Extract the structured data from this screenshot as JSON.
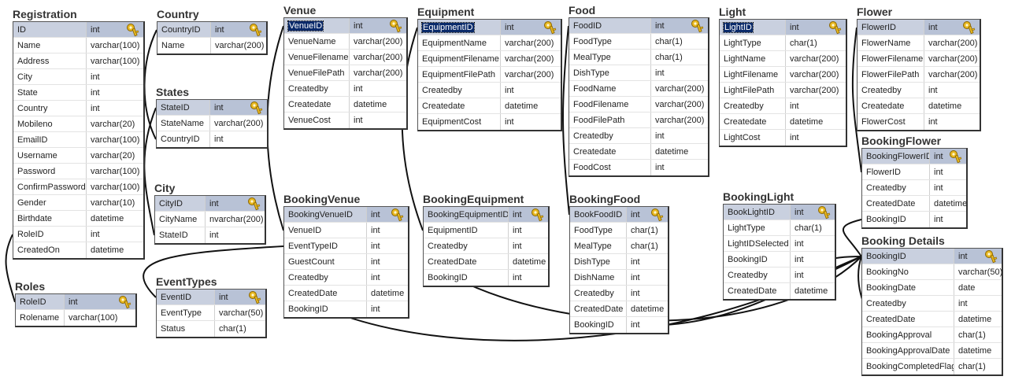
{
  "tables": [
    {
      "id": "registration",
      "title": "Registration",
      "selected": false,
      "rows": [
        {
          "name": "ID",
          "type": "int",
          "pk": true
        },
        {
          "name": "Name",
          "type": "varchar(100)"
        },
        {
          "name": "Address",
          "type": "varchar(100)"
        },
        {
          "name": "City",
          "type": "int"
        },
        {
          "name": "State",
          "type": "int"
        },
        {
          "name": "Country",
          "type": "int"
        },
        {
          "name": "Mobileno",
          "type": "varchar(20)"
        },
        {
          "name": "EmailID",
          "type": "varchar(100)"
        },
        {
          "name": "Username",
          "type": "varchar(20)"
        },
        {
          "name": "Password",
          "type": "varchar(100)"
        },
        {
          "name": "ConfirmPassword",
          "type": "varchar(100)"
        },
        {
          "name": "Gender",
          "type": "varchar(10)"
        },
        {
          "name": "Birthdate",
          "type": "datetime"
        },
        {
          "name": "RoleID",
          "type": "int"
        },
        {
          "name": "CreatedOn",
          "type": "datetime"
        }
      ]
    },
    {
      "id": "roles",
      "title": "Roles",
      "selected": false,
      "rows": [
        {
          "name": "RoleID",
          "type": "int",
          "pk": true
        },
        {
          "name": "Rolename",
          "type": "varchar(100)"
        }
      ]
    },
    {
      "id": "country",
      "title": "Country",
      "selected": false,
      "rows": [
        {
          "name": "CountryID",
          "type": "int",
          "pk": true
        },
        {
          "name": "Name",
          "type": "varchar(200)"
        }
      ]
    },
    {
      "id": "states",
      "title": "States",
      "selected": false,
      "rows": [
        {
          "name": "StateID",
          "type": "int",
          "pk": true
        },
        {
          "name": "StateName",
          "type": "varchar(200)"
        },
        {
          "name": "CountryID",
          "type": "int"
        }
      ]
    },
    {
      "id": "city",
      "title": "City",
      "selected": false,
      "rows": [
        {
          "name": "CityID",
          "type": "int",
          "pk": true
        },
        {
          "name": "CityName",
          "type": "nvarchar(200)"
        },
        {
          "name": "StateID",
          "type": "int"
        }
      ]
    },
    {
      "id": "eventtypes",
      "title": "EventTypes",
      "selected": false,
      "rows": [
        {
          "name": "EventID",
          "type": "int",
          "pk": true
        },
        {
          "name": "EventType",
          "type": "varchar(50)"
        },
        {
          "name": "Status",
          "type": "char(1)"
        }
      ]
    },
    {
      "id": "venue",
      "title": "Venue",
      "selected": true,
      "rows": [
        {
          "name": "VenueID",
          "type": "int",
          "pk": true
        },
        {
          "name": "VenueName",
          "type": "varchar(200)"
        },
        {
          "name": "VenueFilename",
          "type": "varchar(200)"
        },
        {
          "name": "VenueFilePath",
          "type": "varchar(200)"
        },
        {
          "name": "Createdby",
          "type": "int"
        },
        {
          "name": "Createdate",
          "type": "datetime"
        },
        {
          "name": "VenueCost",
          "type": "int"
        }
      ]
    },
    {
      "id": "bookingvenue",
      "title": "BookingVenue",
      "selected": false,
      "rows": [
        {
          "name": "BookingVenueID",
          "type": "int",
          "pk": true
        },
        {
          "name": "VenueID",
          "type": "int"
        },
        {
          "name": "EventTypeID",
          "type": "int"
        },
        {
          "name": "GuestCount",
          "type": "int"
        },
        {
          "name": "Createdby",
          "type": "int"
        },
        {
          "name": "CreatedDate",
          "type": "datetime"
        },
        {
          "name": "BookingID",
          "type": "int"
        }
      ]
    },
    {
      "id": "equipment",
      "title": "Equipment",
      "selected": true,
      "rows": [
        {
          "name": "EquipmentID",
          "type": "int",
          "pk": true
        },
        {
          "name": "EquipmentName",
          "type": "varchar(200)"
        },
        {
          "name": "EquipmentFilename",
          "type": "varchar(200)"
        },
        {
          "name": "EquipmentFilePath",
          "type": "varchar(200)"
        },
        {
          "name": "Createdby",
          "type": "int"
        },
        {
          "name": "Createdate",
          "type": "datetime"
        },
        {
          "name": "EquipmentCost",
          "type": "int"
        }
      ]
    },
    {
      "id": "bookingequipment",
      "title": "BookingEquipment",
      "selected": false,
      "rows": [
        {
          "name": "BookingEquipmentID",
          "type": "int",
          "pk": true
        },
        {
          "name": "EquipmentID",
          "type": "int"
        },
        {
          "name": "Createdby",
          "type": "int"
        },
        {
          "name": "CreatedDate",
          "type": "datetime"
        },
        {
          "name": "BookingID",
          "type": "int"
        }
      ]
    },
    {
      "id": "food",
      "title": "Food",
      "selected": false,
      "rows": [
        {
          "name": "FoodID",
          "type": "int",
          "pk": true
        },
        {
          "name": "FoodType",
          "type": "char(1)"
        },
        {
          "name": "MealType",
          "type": "char(1)"
        },
        {
          "name": "DishType",
          "type": "int"
        },
        {
          "name": "FoodName",
          "type": "varchar(200)"
        },
        {
          "name": "FoodFilename",
          "type": "varchar(200)"
        },
        {
          "name": "FoodFilePath",
          "type": "varchar(200)"
        },
        {
          "name": "Createdby",
          "type": "int"
        },
        {
          "name": "Createdate",
          "type": "datetime"
        },
        {
          "name": "FoodCost",
          "type": "int"
        }
      ]
    },
    {
      "id": "bookingfood",
      "title": "BookingFood",
      "selected": false,
      "rows": [
        {
          "name": "BookFoodID",
          "type": "int",
          "pk": true
        },
        {
          "name": "FoodType",
          "type": "char(1)"
        },
        {
          "name": "MealType",
          "type": "char(1)"
        },
        {
          "name": "DishType",
          "type": "int"
        },
        {
          "name": "DishName",
          "type": "int"
        },
        {
          "name": "Createdby",
          "type": "int"
        },
        {
          "name": "CreatedDate",
          "type": "datetime"
        },
        {
          "name": "BookingID",
          "type": "int"
        }
      ]
    },
    {
      "id": "light",
      "title": "Light",
      "selected": true,
      "rows": [
        {
          "name": "LightID",
          "type": "int",
          "pk": true
        },
        {
          "name": "LightType",
          "type": "char(1)"
        },
        {
          "name": "LightName",
          "type": "varchar(200)"
        },
        {
          "name": "LightFilename",
          "type": "varchar(200)"
        },
        {
          "name": "LightFilePath",
          "type": "varchar(200)"
        },
        {
          "name": "Createdby",
          "type": "int"
        },
        {
          "name": "Createdate",
          "type": "datetime"
        },
        {
          "name": "LightCost",
          "type": "int"
        }
      ]
    },
    {
      "id": "bookinglight",
      "title": "BookingLight",
      "selected": false,
      "rows": [
        {
          "name": "BookLightID",
          "type": "int",
          "pk": true
        },
        {
          "name": "LightType",
          "type": "char(1)"
        },
        {
          "name": "LightIDSelected",
          "type": "int"
        },
        {
          "name": "BookingID",
          "type": "int"
        },
        {
          "name": "Createdby",
          "type": "int"
        },
        {
          "name": "CreatedDate",
          "type": "datetime"
        }
      ]
    },
    {
      "id": "flower",
      "title": "Flower",
      "selected": false,
      "rows": [
        {
          "name": "FlowerID",
          "type": "int",
          "pk": true
        },
        {
          "name": "FlowerName",
          "type": "varchar(200)"
        },
        {
          "name": "FlowerFilename",
          "type": "varchar(200)"
        },
        {
          "name": "FlowerFilePath",
          "type": "varchar(200)"
        },
        {
          "name": "Createdby",
          "type": "int"
        },
        {
          "name": "Createdate",
          "type": "datetime"
        },
        {
          "name": "FlowerCost",
          "type": "int"
        }
      ]
    },
    {
      "id": "bookingflower",
      "title": "BookingFlower",
      "selected": false,
      "rows": [
        {
          "name": "BookingFlowerID",
          "type": "int",
          "pk": true
        },
        {
          "name": "FlowerID",
          "type": "int"
        },
        {
          "name": "Createdby",
          "type": "int"
        },
        {
          "name": "CreatedDate",
          "type": "datetime"
        },
        {
          "name": "BookingID",
          "type": "int"
        }
      ]
    },
    {
      "id": "bookingdetails",
      "title": "Booking Details",
      "selected": false,
      "rows": [
        {
          "name": "BookingID",
          "type": "int",
          "pk": true
        },
        {
          "name": "BookingNo",
          "type": "varchar(50)"
        },
        {
          "name": "BookingDate",
          "type": "date"
        },
        {
          "name": "Createdby",
          "type": "int"
        },
        {
          "name": "CreatedDate",
          "type": "datetime"
        },
        {
          "name": "BookingApproval",
          "type": "char(1)"
        },
        {
          "name": "BookingApprovalDate",
          "type": "datetime"
        },
        {
          "name": "BookingCompletedFlag",
          "type": "char(1)"
        }
      ]
    }
  ],
  "relationships": [
    {
      "from": "registration.RoleID",
      "to": "roles.RoleID"
    },
    {
      "from": "states.CountryID",
      "to": "country.CountryID"
    },
    {
      "from": "city.StateID",
      "to": "states.StateID"
    },
    {
      "from": "bookingvenue.VenueID",
      "to": "venue.VenueID"
    },
    {
      "from": "bookingvenue.EventTypeID",
      "to": "eventtypes.EventID"
    },
    {
      "from": "bookingequipment.EquipmentID",
      "to": "equipment.EquipmentID"
    },
    {
      "from": "bookingfood.BookFoodID",
      "to": "food.FoodID"
    },
    {
      "from": "bookingflower.FlowerID",
      "to": "flower.FlowerID"
    },
    {
      "from": "bookingvenue.BookingID",
      "to": "bookingdetails.BookingID"
    },
    {
      "from": "bookingequipment.BookingID",
      "to": "bookingdetails.BookingID"
    },
    {
      "from": "bookingfood.BookingID",
      "to": "bookingdetails.BookingID"
    },
    {
      "from": "bookinglight.BookingID",
      "to": "bookingdetails.BookingID"
    },
    {
      "from": "bookingflower.BookingID",
      "to": "bookingdetails.BookingID"
    }
  ],
  "colors": {
    "pk_row": "#b8c2d6",
    "selected_pk": "#0a2a6a",
    "border": "#555555",
    "line": "#111111"
  },
  "icons": {
    "primary_key": "key-icon"
  }
}
